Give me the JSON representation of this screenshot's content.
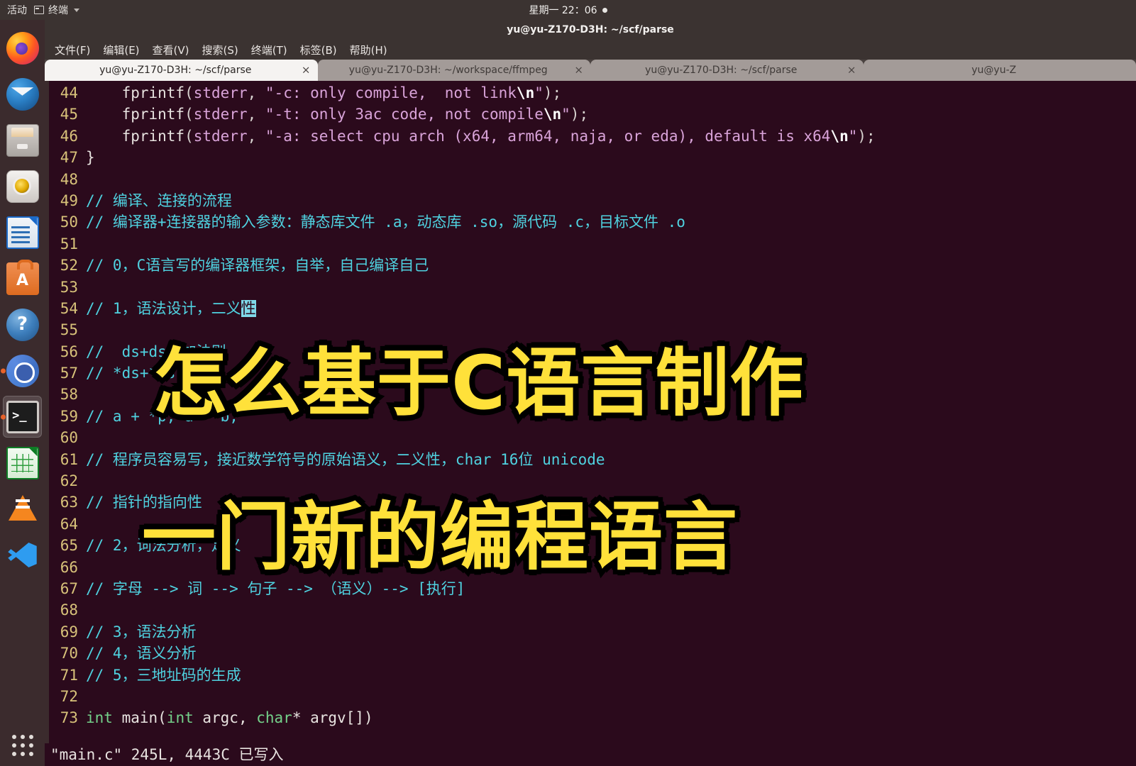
{
  "topbar": {
    "activities": "活动",
    "app_menu": "终端",
    "clock": "星期一 22：06"
  },
  "dock": {
    "items": [
      {
        "name": "firefox",
        "label": "Firefox"
      },
      {
        "name": "thunderbird",
        "label": "Thunderbird"
      },
      {
        "name": "files",
        "label": "文件"
      },
      {
        "name": "rhythmbox",
        "label": "Rhythmbox"
      },
      {
        "name": "libreoffice-writer",
        "label": "LibreOffice Writer"
      },
      {
        "name": "ubuntu-software",
        "label": "Ubuntu 软件"
      },
      {
        "name": "help",
        "label": "帮助"
      },
      {
        "name": "chromium",
        "label": "Chromium"
      },
      {
        "name": "terminal",
        "label": "终端"
      },
      {
        "name": "libreoffice-calc",
        "label": "LibreOffice Calc"
      },
      {
        "name": "vlc",
        "label": "VLC"
      },
      {
        "name": "vscode",
        "label": "Visual Studio Code"
      }
    ],
    "show_apps": "显示应用程序"
  },
  "window": {
    "title": "yu@yu-Z170-D3H: ~/scf/parse"
  },
  "menubar": [
    {
      "label": "文件(F)"
    },
    {
      "label": "编辑(E)"
    },
    {
      "label": "查看(V)"
    },
    {
      "label": "搜索(S)"
    },
    {
      "label": "终端(T)"
    },
    {
      "label": "标签(B)"
    },
    {
      "label": "帮助(H)"
    }
  ],
  "tabs": [
    {
      "label": "yu@yu-Z170-D3H: ~/scf/parse",
      "close": "×",
      "active": true
    },
    {
      "label": "yu@yu-Z170-D3H: ~/workspace/ffmpeg",
      "close": "×",
      "active": false
    },
    {
      "label": "yu@yu-Z170-D3H: ~/scf/parse",
      "close": "×",
      "active": false
    },
    {
      "label": "yu@yu-Z",
      "close": "",
      "active": false
    }
  ],
  "editor": {
    "status": "\"main.c\" 245L, 4443C 已写入",
    "lines": [
      {
        "n": "44",
        "t": "    fprintf(stderr, \"-c: only compile,  not link\\n\");"
      },
      {
        "n": "45",
        "t": "    fprintf(stderr, \"-t: only 3ac code, not compile\\n\");"
      },
      {
        "n": "46",
        "t": "    fprintf(stderr, \"-a: select cpu arch (x64, arm64, naja, or eda), default is x64\\n\");"
      },
      {
        "n": "47",
        "t": "}"
      },
      {
        "n": "48",
        "t": ""
      },
      {
        "n": "49",
        "t": "// 编译、连接的流程"
      },
      {
        "n": "50",
        "t": "// 编译器+连接器的输入参数：静态库文件 .a，动态库 .so，源代码 .c，目标文件 .o"
      },
      {
        "n": "51",
        "t": ""
      },
      {
        "n": "52",
        "t": "// 0，C语言写的编译器框架，自举，自己编译自己"
      },
      {
        "n": "53",
        "t": ""
      },
      {
        "n": "54",
        "t": "// 1，语法设计，二义性"
      },
      {
        "n": "55",
        "t": ""
      },
      {
        "n": "56",
        "t": "//  ds+ds，加法则"
      },
      {
        "n": "57",
        "t": "// *ds+*ds"
      },
      {
        "n": "58",
        "t": ""
      },
      {
        "n": "59",
        "t": "// a + *p, a * b,"
      },
      {
        "n": "60",
        "t": ""
      },
      {
        "n": "61",
        "t": "// 程序员容易写，接近数学符号的原始语义，二义性，char 16位 unicode"
      },
      {
        "n": "62",
        "t": ""
      },
      {
        "n": "63",
        "t": "// 指针的指向性"
      },
      {
        "n": "64",
        "t": ""
      },
      {
        "n": "65",
        "t": "// 2，词法分析，定义"
      },
      {
        "n": "66",
        "t": ""
      },
      {
        "n": "67",
        "t": "// 字母 --> 词 --> 句子 --> （语义）--> [执行]"
      },
      {
        "n": "68",
        "t": ""
      },
      {
        "n": "69",
        "t": "// 3，语法分析"
      },
      {
        "n": "70",
        "t": "// 4，语义分析"
      },
      {
        "n": "71",
        "t": "// 5，三地址码的生成"
      },
      {
        "n": "72",
        "t": ""
      },
      {
        "n": "73",
        "t": "int main(int argc, char* argv[])"
      }
    ]
  },
  "captions": {
    "line1": "怎么基于C语言制作",
    "line2": "一门新的编程语言"
  }
}
